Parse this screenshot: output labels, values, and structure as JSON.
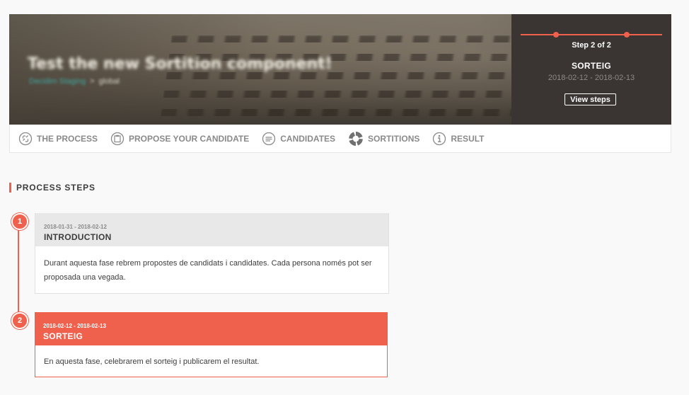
{
  "hero": {
    "title": "Test the new Sortition component!",
    "organization": "Decidim Staging",
    "scope": "global"
  },
  "step_panel": {
    "step_count": "Step 2 of 2",
    "step_name": "SORTEIG",
    "step_dates": "2018-02-12 - 2018-02-13",
    "view_steps_label": "View steps",
    "accent_color": "#ef604d"
  },
  "nav": {
    "items": [
      {
        "label": "THE PROCESS",
        "icon": "process-icon"
      },
      {
        "label": "PROPOSE YOUR CANDIDATE",
        "icon": "proposal-icon"
      },
      {
        "label": "CANDIDATES",
        "icon": "candidates-icon"
      },
      {
        "label": "SORTITIONS",
        "icon": "sortitions-icon"
      },
      {
        "label": "RESULT",
        "icon": "result-icon"
      }
    ]
  },
  "section": {
    "title": "PROCESS STEPS"
  },
  "steps": [
    {
      "number": "1",
      "dates": "2018-01-31 - 2018-02-12",
      "title": "INTRODUCTION",
      "description": "Durant aquesta fase rebrem propostes de candidats i candidates. Cada persona només pot ser proposada una vegada.",
      "active": false
    },
    {
      "number": "2",
      "dates": "2018-02-12 - 2018-02-13",
      "title": "SORTEIG",
      "description": "En aquesta fase, celebrarem el sorteig i publicarem el resultat.",
      "active": true
    }
  ]
}
